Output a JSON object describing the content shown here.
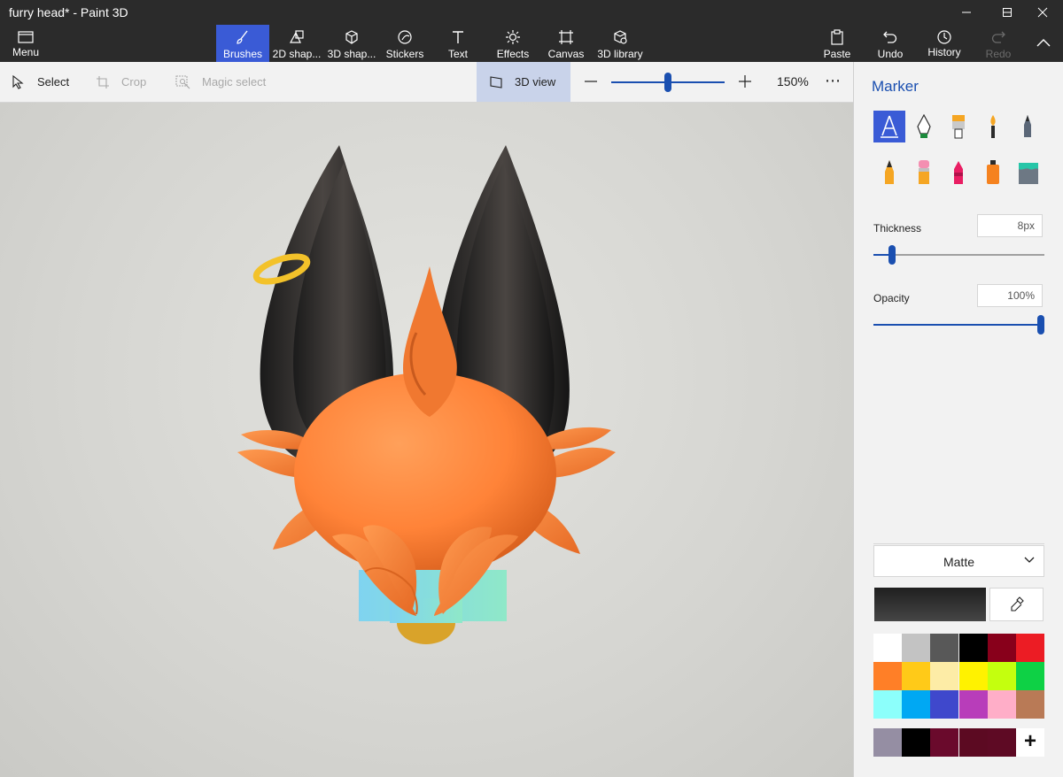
{
  "window": {
    "title": "furry head* - Paint 3D"
  },
  "ribbon": {
    "menu_label": "Menu",
    "tabs": [
      {
        "label": "Brushes",
        "icon": "brush-icon",
        "active": true
      },
      {
        "label": "2D shap...",
        "icon": "2d-shapes-icon"
      },
      {
        "label": "3D shap...",
        "icon": "3d-shapes-icon"
      },
      {
        "label": "Stickers",
        "icon": "stickers-icon"
      },
      {
        "label": "Text",
        "icon": "text-icon"
      },
      {
        "label": "Effects",
        "icon": "effects-icon"
      },
      {
        "label": "Canvas",
        "icon": "canvas-icon"
      },
      {
        "label": "3D library",
        "icon": "3d-library-icon"
      }
    ],
    "actions": [
      {
        "label": "Paste",
        "icon": "paste-icon"
      },
      {
        "label": "Undo",
        "icon": "undo-icon"
      },
      {
        "label": "History",
        "icon": "history-icon"
      },
      {
        "label": "Redo",
        "icon": "redo-icon",
        "disabled": true
      }
    ]
  },
  "toolbar": {
    "select_label": "Select",
    "crop_label": "Crop",
    "magic_select_label": "Magic select",
    "view3d_label": "3D view",
    "zoom_value": "150%",
    "zoom_level": 0.5,
    "more_label": "⋯"
  },
  "panel": {
    "title": "Marker",
    "brushes": [
      "marker-icon",
      "calligraphy-pen-icon",
      "oil-brush-icon",
      "watercolor-icon",
      "pixel-pen-icon",
      "pencil-icon",
      "eraser-icon",
      "crayon-icon",
      "spray-can-icon",
      "fill-bucket-icon"
    ],
    "thickness_label": "Thickness",
    "thickness_value": "8px",
    "thickness_level": 0.09,
    "opacity_label": "Opacity",
    "opacity_value": "100%",
    "opacity_level": 1.0,
    "material_label": "Matte",
    "current_color": "#1f1f1f",
    "palette": [
      "#ffffff",
      "#c3c3c3",
      "#585858",
      "#000000",
      "#88001b",
      "#ec1c24",
      "#ff7f27",
      "#ffca18",
      "#fdeca6",
      "#fff200",
      "#c4ff0e",
      "#0ed145",
      "#8cfffb",
      "#00a8f3",
      "#3f48cc",
      "#b83dba",
      "#ffaec8",
      "#b97a56"
    ],
    "custom_colors": [
      "#958ea3",
      "#000000",
      "#6a0a2c",
      "#5c0a22",
      "#5e0a24"
    ],
    "add_label": "+"
  },
  "colors": {
    "accent": "#3a5bd6",
    "accent_dark": "#1a4fb0",
    "ribbon_bg": "#2b2b2b"
  }
}
